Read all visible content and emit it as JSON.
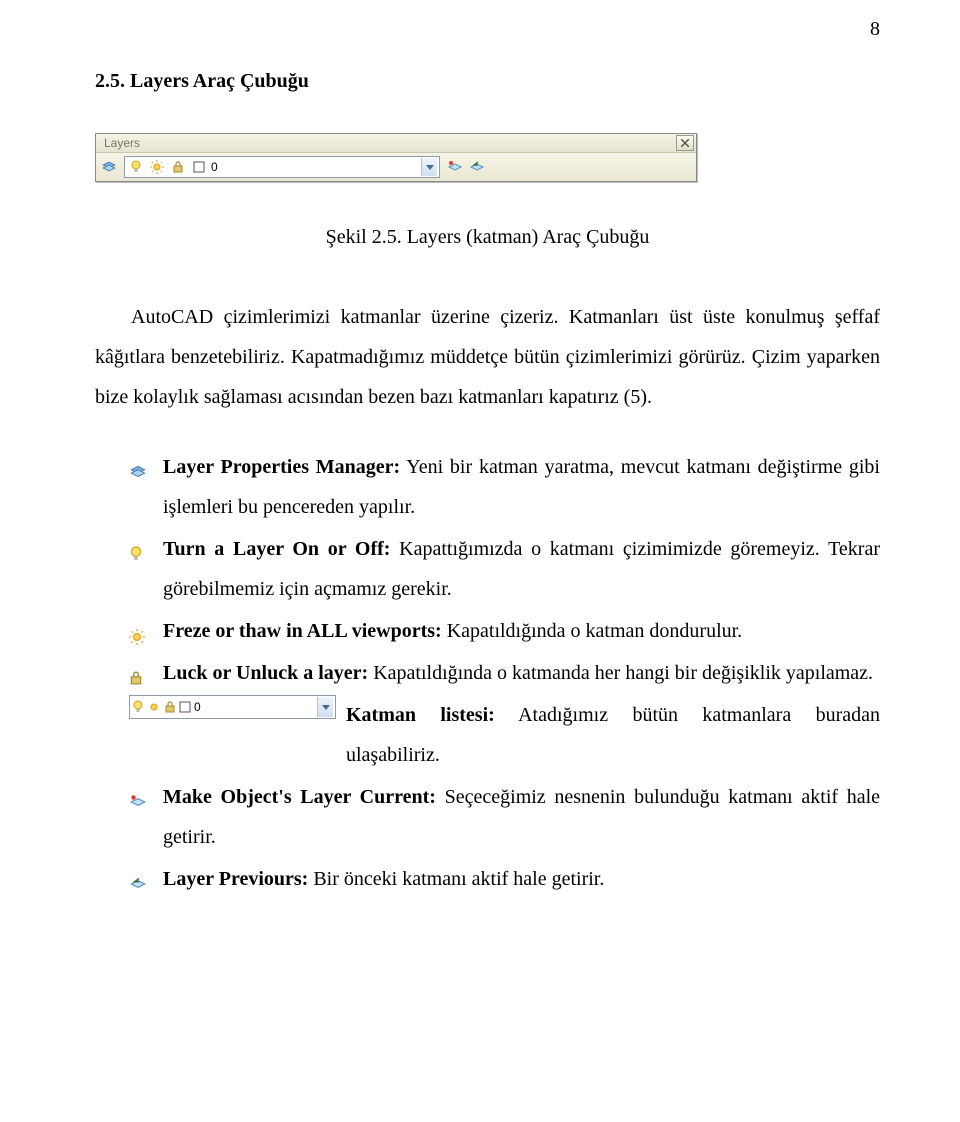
{
  "page_number": "8",
  "heading": "2.5. Layers Araç Çubuğu",
  "toolbar": {
    "title": "Layers",
    "layer_name": "0",
    "close_icon": "X"
  },
  "caption": "Şekil 2.5. Layers (katman) Araç Çubuğu",
  "paragraph": "AutoCAD çizimlerimizi katmanlar üzerine çizeriz. Katmanları üst üste konulmuş şeffaf kâğıtlara benzetebiliriz. Kapatmadığımız müddetçe bütün çizimlerimizi görürüz. Çizim yaparken bize kolaylık sağlaması acısından bezen bazı katmanları kapatırız (5).",
  "list": {
    "i0": {
      "term": "Layer Properties Manager:",
      "desc": " Yeni bir katman yaratma, mevcut katmanı değiştirme gibi işlemleri bu pencereden yapılır."
    },
    "i1": {
      "term": "Turn a Layer On or Off:",
      "desc": " Kapattığımızda o katmanı çizimimizde göremeyiz. Tekrar görebilmemiz için açmamız gerekir."
    },
    "i2": {
      "term": "Freze or thaw in ALL viewports:",
      "desc": " Kapatıldığında o katman dondurulur."
    },
    "i3": {
      "term": "Luck or Unluck a layer:",
      "desc": " Kapatıldığında o katmanda her hangi bir değişiklik yapılamaz."
    },
    "i4": {
      "term": "Katman listesi:",
      "desc": " Atadığımız bütün katmanlara buradan ulaşabiliriz.",
      "dd_layer_name": "0"
    },
    "i5": {
      "term": "Make Object's Layer Current:",
      "desc": " Seçeceğimiz nesnenin bulunduğu katmanı aktif hale getirir."
    },
    "i6": {
      "term": "Layer Previours:",
      "desc": " Bir önceki katmanı aktif hale getirir."
    }
  }
}
